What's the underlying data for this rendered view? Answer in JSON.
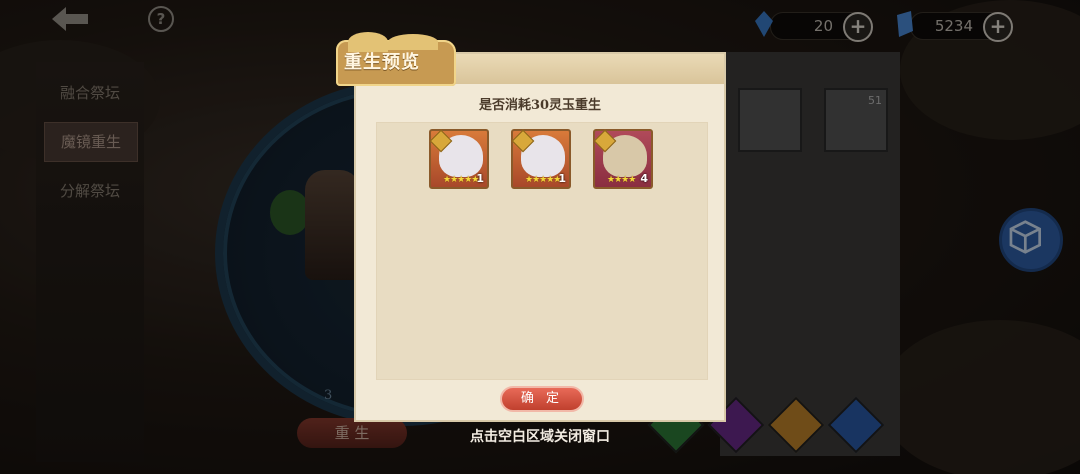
{
  "topbar": {
    "help_icon": "?",
    "currency_jade": "20",
    "currency_crystal": "5234",
    "plus_icon": "+"
  },
  "sidebar": {
    "items": [
      {
        "label": "融合祭坛"
      },
      {
        "label": "魔镜重生"
      },
      {
        "label": "分解祭坛"
      }
    ]
  },
  "main": {
    "rebirth_button": "重 生",
    "cost_small": "3",
    "portrait_num": "51"
  },
  "dialog": {
    "title": "重生预览",
    "question": "是否消耗30灵玉重生",
    "items": [
      {
        "stars": "★★★★★",
        "count": "1"
      },
      {
        "stars": "★★★★★",
        "count": "1"
      },
      {
        "stars": "★★★★",
        "count": "4"
      }
    ],
    "confirm_label": "确 定"
  },
  "close_hint": "点击空白区域关闭窗口",
  "colors": {
    "dialog_bg": "#f2e9d6",
    "title_tab": "#c79a52",
    "confirm": "#d6503e"
  }
}
